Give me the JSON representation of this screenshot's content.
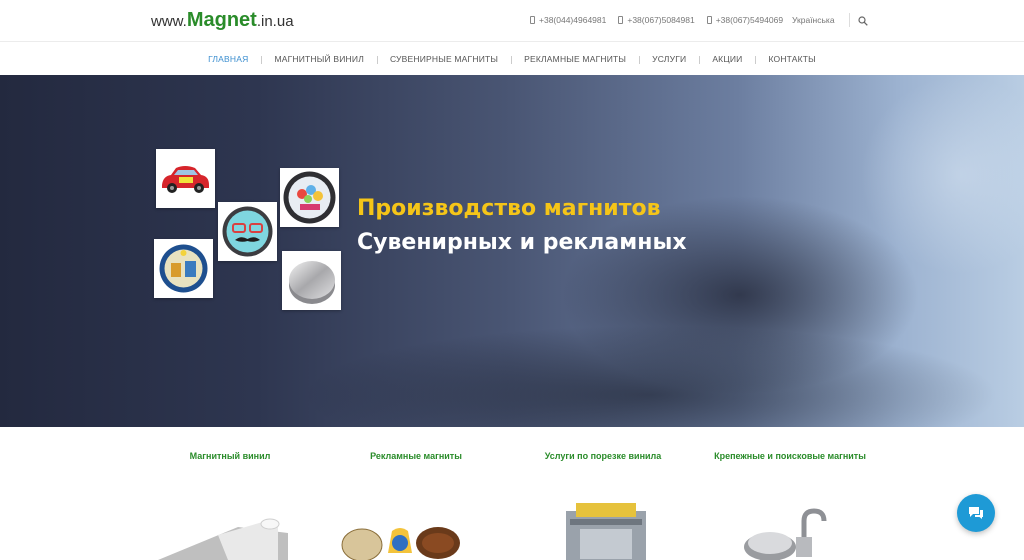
{
  "header": {
    "logo": {
      "prefix": "www.",
      "brand": "Magnet",
      "suffix": ".in.ua"
    },
    "phones": [
      "+38(044)4964981",
      "+38(067)5084981",
      "+38(067)5494069"
    ],
    "language": "Українська"
  },
  "nav": {
    "items": [
      "ГЛАВНАЯ",
      "МАГНИТНЫЙ ВИНИЛ",
      "СУВЕНИРНЫЕ МАГНИТЫ",
      "РЕКЛАМНЫЕ МАГНИТЫ",
      "УСЛУГИ",
      "АКЦИИ",
      "КОНТАКТЫ"
    ],
    "active_index": 0
  },
  "hero": {
    "title": "Производство магнитов",
    "subtitle": "Сувенирных и рекламных"
  },
  "categories": [
    {
      "title": "Магнитный винил"
    },
    {
      "title": "Рекламные магниты"
    },
    {
      "title": "Услуги по порезке винила"
    },
    {
      "title": "Крепежные и поисковые магниты"
    }
  ],
  "colors": {
    "brand_green": "#2a8c2a",
    "nav_active": "#3d8fd0",
    "hero_title": "#f5c518",
    "chat_button": "#1e9ad6"
  },
  "icons": [
    "phone-icon",
    "search-icon",
    "chat-icon"
  ]
}
